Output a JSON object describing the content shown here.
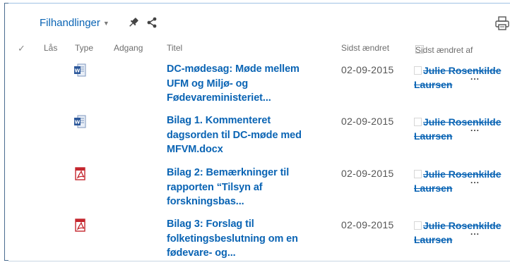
{
  "toolbar": {
    "menu_label": "Filhandlinger",
    "pin_icon": "pin-icon",
    "share_icon": "share-icon",
    "print_icon": "print-icon"
  },
  "columns": {
    "check": "✓",
    "las": "Lås",
    "type": "Type",
    "adgang": "Adgang",
    "titel": "Titel",
    "sidst_aendret": "Sidst ændret",
    "sidst_aendret_af": "Sidst ændret af"
  },
  "rows": [
    {
      "type": "word",
      "title": "DC-mødesag: Møde mellem UFM og Miljø- og Fødevareministeriet...",
      "date": "02-09-2015",
      "author_first": "Julie Rosenkilde",
      "author_last": "Laursen"
    },
    {
      "type": "word",
      "title": "Bilag 1. Kommenteret dagsorden til DC-møde med MFVM.docx",
      "date": "02-09-2015",
      "author_first": "Julie Rosenkilde",
      "author_last": "Laursen"
    },
    {
      "type": "pdf",
      "title": "Bilag 2: Bemærkninger til rapporten “Tilsyn af forskningsbas...",
      "date": "02-09-2015",
      "author_first": "Julie Rosenkilde",
      "author_last": "Laursen"
    },
    {
      "type": "pdf",
      "title": "Bilag 3: Forslag til folketingsbeslutning om en fødevare- og...",
      "date": "02-09-2015",
      "author_first": "Julie Rosenkilde",
      "author_last": "Laursen"
    }
  ],
  "ellipsis": "...",
  "colors": {
    "link": "#0a64b4",
    "pdf_red": "#c4262e",
    "word_blue": "#2b579a"
  }
}
